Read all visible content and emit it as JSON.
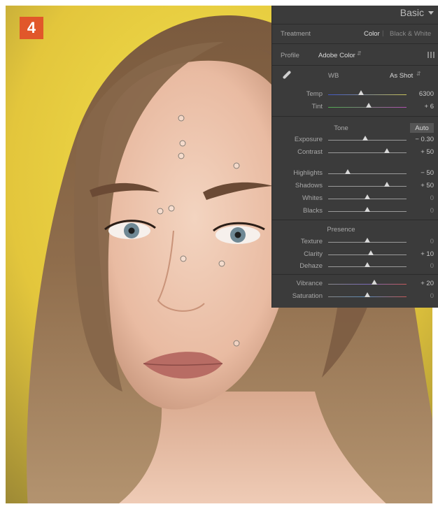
{
  "step_number": "4",
  "panel": {
    "title": "Basic",
    "treatment": {
      "label": "Treatment",
      "color": "Color",
      "bw": "Black & White",
      "selected": "Color"
    },
    "profile": {
      "label": "Profile",
      "value": "Adobe Color"
    },
    "wb": {
      "label": "WB",
      "value": "As Shot"
    },
    "sliders_wb": [
      {
        "label": "Temp",
        "value": "6300",
        "position": 0.34,
        "track": "temp"
      },
      {
        "label": "Tint",
        "value": "+ 6",
        "position": 0.52,
        "track": "tint"
      }
    ],
    "tone": {
      "title": "Tone",
      "auto_label": "Auto"
    },
    "sliders_tone": [
      {
        "label": "Exposure",
        "value": "− 0.30",
        "position": 0.47
      },
      {
        "label": "Contrast",
        "value": "+ 50",
        "position": 0.75
      },
      {
        "label": "Highlights",
        "value": "− 50",
        "position": 0.25
      },
      {
        "label": "Shadows",
        "value": "+ 50",
        "position": 0.75
      },
      {
        "label": "Whites",
        "value": "0",
        "position": 0.5
      },
      {
        "label": "Blacks",
        "value": "0",
        "position": 0.5
      }
    ],
    "presence": {
      "title": "Presence"
    },
    "sliders_presence": [
      {
        "label": "Texture",
        "value": "0",
        "position": 0.5
      },
      {
        "label": "Clarity",
        "value": "+ 10",
        "position": 0.55
      },
      {
        "label": "Dehaze",
        "value": "0",
        "position": 0.5
      },
      {
        "label": "Vibrance",
        "value": "+ 20",
        "position": 0.6,
        "track": "vibrance"
      },
      {
        "label": "Saturation",
        "value": "0",
        "position": 0.5,
        "track": "saturation"
      }
    ]
  }
}
